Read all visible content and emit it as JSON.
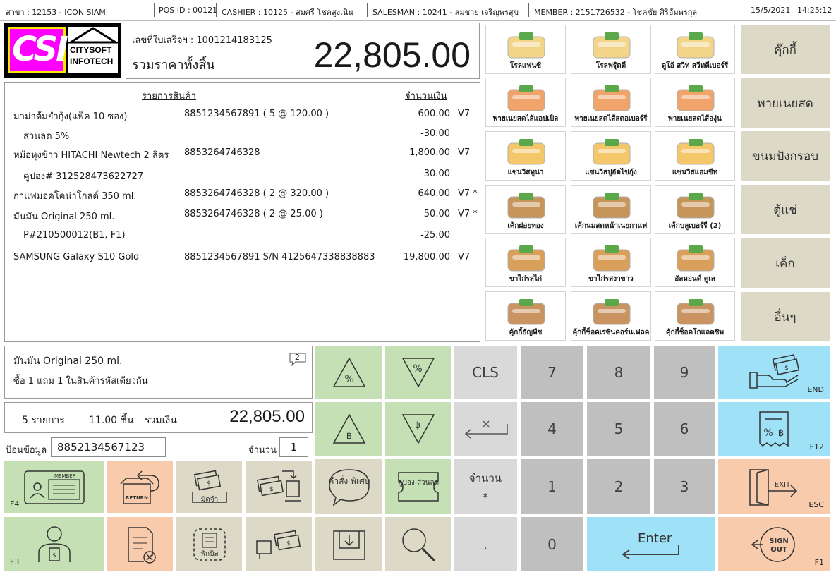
{
  "status": {
    "branch": "สาขา : 12153 - ICON SIAM",
    "pos": "POS ID : 00121",
    "cashier": "CASHIER :  10125 - สมศรี โชคสูงเนิน",
    "salesman": "SALESMAN : 10241 - สมชาย เจริญพรสุข",
    "member": "MEMBER : 2151726532 - โชคชัย ศิริอัมพรกุล",
    "date": "15/5/2021",
    "time": "14:25:12"
  },
  "logo": {
    "brand_mark": "CSI",
    "line1": "CITYSOFT",
    "line2": "INFOTECH",
    "colors": {
      "magenta": "#ff00ff",
      "yellow": "#ffe600"
    }
  },
  "receipt": {
    "number": "เลขที่ใบเสร็จฯ : 1001214183125",
    "total_label": "รวมราคาทั้งสิ้น",
    "total": "22,805.00"
  },
  "items": {
    "header_product": "รายการสินค้า",
    "header_amount": "จำนวนเงิน",
    "rows": [
      {
        "name": "มาม่าต้มยำกุ้ง(แพ็ค 10 ซอง)",
        "code": "8851234567891 (  5 @ 120.00 )",
        "amount": "600.00",
        "vat": "V7"
      },
      {
        "name": "   ส่วนลด 5%",
        "code": "",
        "amount": "-30.00",
        "vat": ""
      },
      {
        "name": "หม้อหุงข้าว HITACHI Newtech 2 ลิตร",
        "code": "8853264746328",
        "amount": "1,800.00",
        "vat": "V7"
      },
      {
        "name": "   คูปอง# 312528473622727",
        "code": "",
        "amount": "-30.00",
        "vat": ""
      },
      {
        "name": "กาแฟมอคโคน่าโกลด์ 350 ml.",
        "code": "8853264746328 ( 2 @ 320.00 )",
        "amount": "640.00",
        "vat": "V7 *"
      },
      {
        "name": "มันมัน Original 250 ml.",
        "code": "8853264746328 ( 2 @ 25.00 )",
        "amount": "50.00",
        "vat": "V7 *"
      },
      {
        "name": "   P#210500012(B1, F1)",
        "code": "",
        "amount": "-25.00",
        "vat": ""
      },
      {
        "name": "SAMSUNG Galaxy S10 Gold",
        "code": "8851234567891  S/N 4125647338838883",
        "amount": "19,800.00",
        "vat": "V7"
      }
    ]
  },
  "products": [
    [
      "โรลแฟนซี",
      "โรลฟรุ๊ตตี้",
      "ดูโอ้ สวีท สวีทตี้เบอร์รี่"
    ],
    [
      "พายเนยสดไส้แอปเปิ้ล",
      "พายเนยสดไส้สตอเบอร์รี่",
      "พายเนยสดไส้องุ่น"
    ],
    [
      "แซนวิสทูน่า",
      "แซนวิสปูอัดไข่กุ้ง",
      "แซนวิสแฮมชีท"
    ],
    [
      "เค้กฝอยทอง",
      "เค้กนมสดหน้าเนยกาแฟ",
      "เค้กบลูเบอร์รี่ (2)"
    ],
    [
      "ขาไก่รสไก่",
      "ขาไก่รสงาขาว",
      "อัลมอนด์ ตูเล"
    ],
    [
      "คุ้กกี้ธัญพืช",
      "คุ้กกี้ช็อคเรซินคอร์นเฟลค",
      "คุ้กกี้ช็อคโกแลตชิพ"
    ]
  ],
  "categories": [
    "คุ๊กกี้",
    "พายเนยสด",
    "ขนมปังกรอบ",
    "ตู้แช่",
    "เค็ก",
    "อื่นๆ"
  ],
  "promo": {
    "title": "มันมัน Original 250 ml.",
    "detail": "ซื้อ 1 แถม 1  ในสินค้ารหัสเดียวกัน",
    "badge": "2"
  },
  "summary": {
    "items": "5 รายการ",
    "qty": "11.00  ชิ้น",
    "total_label": "รวมเงิน",
    "total": "22,805.00"
  },
  "input": {
    "label": "ป้อนข้อมูล",
    "value": "8852134567123",
    "qty_label": "จำนวน",
    "qty": "1"
  },
  "keys": {
    "cls": "CLS",
    "qty": "จำนวน",
    "qty_sub": "*",
    "dot": ".",
    "enter": "Enter",
    "n7": "7",
    "n8": "8",
    "n9": "9",
    "n4": "4",
    "n5": "5",
    "n6": "6",
    "n1": "1",
    "n2": "2",
    "n3": "3",
    "n0": "0",
    "end": "END",
    "f12": "F12",
    "esc": "ESC",
    "f1": "F1",
    "f4": "F4",
    "f3": "F3",
    "member": "MEMBER",
    "return": "RETURN",
    "deposit": "มัดจำ",
    "special": "คำสั่ง พิเศษ",
    "coupon": "คูปอง ส่วนลด",
    "hold": "พักบิล",
    "exit": "EXIT",
    "signout1": "SIGN",
    "signout2": "OUT"
  },
  "icons": {
    "promo_bubble": "speech-bubble-icon"
  }
}
